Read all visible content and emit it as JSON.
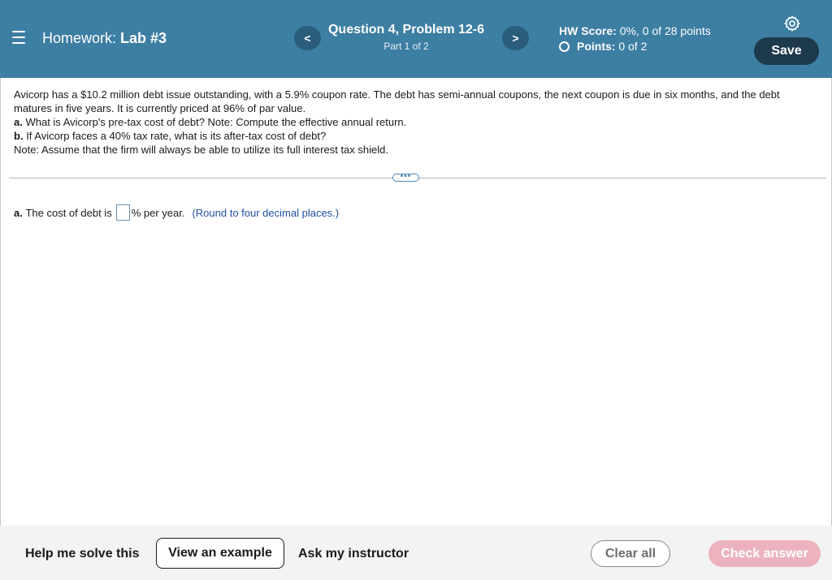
{
  "header": {
    "hw_label": "Homework:",
    "hw_name": "Lab #3",
    "question_title": "Question 4, Problem 12-6",
    "question_part": "Part 1 of 2",
    "prev_glyph": "<",
    "next_glyph": ">",
    "score_label": "HW Score:",
    "score_value": "0%, 0 of 28 points",
    "points_label": "Points:",
    "points_value": "0 of 2",
    "save_label": "Save",
    "icons": [
      "menu-icon",
      "gear-icon",
      "chevron-left-icon",
      "chevron-right-icon",
      "radio-circle-icon"
    ]
  },
  "problem": {
    "line1": "Avicorp has a $10.2 million debt issue outstanding, with a 5.9% coupon rate. The debt has semi-annual coupons, the next coupon is due in six months, and the debt matures in five years. It is currently priced at 96% of par value.",
    "a_prefix": "a.",
    "a_text": "What is Avicorp's pre-tax cost of debt? Note: Compute the effective annual return.",
    "b_prefix": "b.",
    "b_text": "If Avicorp faces a 40% tax rate, what is its after-tax cost of debt?",
    "note": "Note: Assume that the firm will always be able to utilize its full interest tax shield."
  },
  "divider": {
    "more_glyph": "•••"
  },
  "answer": {
    "prefix": "a.",
    "text_before": "The cost of debt is",
    "value": "",
    "text_after": "% per year.",
    "hint": "(Round to four decimal places.)"
  },
  "footer": {
    "help_label": "Help me solve this",
    "example_label": "View an example",
    "ask_label": "Ask my instructor",
    "clear_label": "Clear all",
    "check_label": "Check answer"
  },
  "colors": {
    "header_bg": "#3d7ea3",
    "save_bg": "#1d3a4d",
    "check_bg": "#ecb3bf",
    "hint_color": "#1f4fa0"
  }
}
